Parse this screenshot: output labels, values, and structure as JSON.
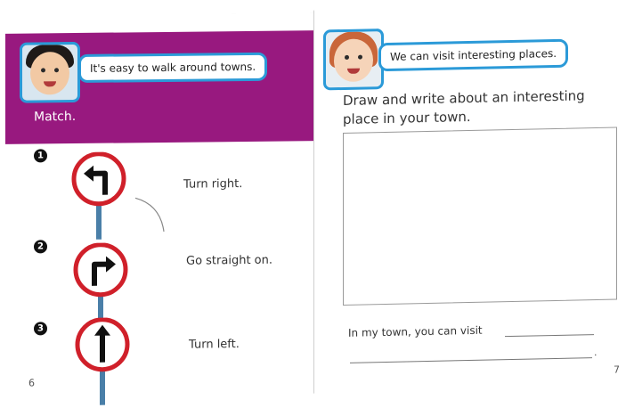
{
  "left_page": {
    "speech": "It's easy to walk around towns.",
    "activity_label": "Match.",
    "items": [
      {
        "number": "1",
        "sign": "turn-left-arrow-sign",
        "instruction": "Turn right."
      },
      {
        "number": "2",
        "sign": "turn-right-arrow-sign",
        "instruction": "Go straight on."
      },
      {
        "number": "3",
        "sign": "straight-arrow-sign",
        "instruction": "Turn left."
      }
    ],
    "page_number": "6"
  },
  "right_page": {
    "speech": "We can visit interesting places.",
    "prompt": "Draw and write about an interesting place in your town.",
    "sentence_start": "In my town, you can visit",
    "sentence_end": ".",
    "page_number": "7"
  },
  "colors": {
    "banner": "#98197f",
    "speech_border": "#2b9ad8",
    "sign_ring": "#d0202a"
  }
}
